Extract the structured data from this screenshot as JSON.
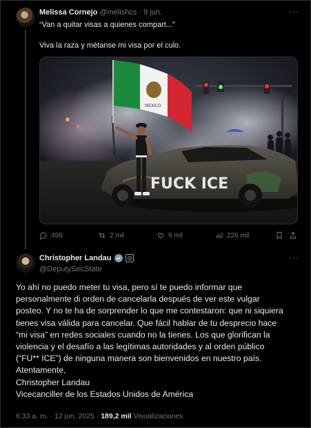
{
  "reply_tweet": {
    "author_name": "Melissa Cornejo",
    "author_handle": "@melishcs",
    "separator": "·",
    "date": "9 jun.",
    "more": "···",
    "text_line1": "“Van a quitar visas a quienes compart...”",
    "text_line2": "Viva la raza y métanse mi visa por el culo.",
    "image": {
      "flag_text": "MEXICO",
      "car_graffiti": "FUCK ICE"
    },
    "actions": {
      "replies": "499",
      "reposts": "2 mil",
      "likes": "9 mil",
      "views": "226 mil"
    }
  },
  "main_tweet": {
    "author_name": "Christopher Landau",
    "author_handle": "@DeputySecState",
    "more": "···",
    "body_lines": [
      "Yo ahí no puedo meter tu visa, pero sí te puedo informar que",
      "personalmente di orden de cancelarla después de ver este vulgar",
      "posteo. Y no te ha de sorprender lo que me contestaron: que ni siquiera",
      "tienes visa válida para cancelar. Que fácil hablar de tu desprecio hace",
      "“mi visa” en redes sociales cuando no la tienes. Los que glorifican la",
      "violencia y el desafío a las legítimas autoridades y al orden público",
      "(“FU** ICE”) de ninguna manera son bienvenidos en nuestro país.",
      "Atentamente,",
      "Christopher Landau",
      "Vicecanciller de los Estados Unidos de América"
    ],
    "time": "6:33 a. m.",
    "date": "12 jun. 2025",
    "dot": "·",
    "views_count": "189,2 mil",
    "views_label": "Visualizaciones"
  },
  "colors": {
    "background": "#000000",
    "text": "#e7e9ea",
    "muted": "#71767b",
    "verified": "#829aab"
  }
}
